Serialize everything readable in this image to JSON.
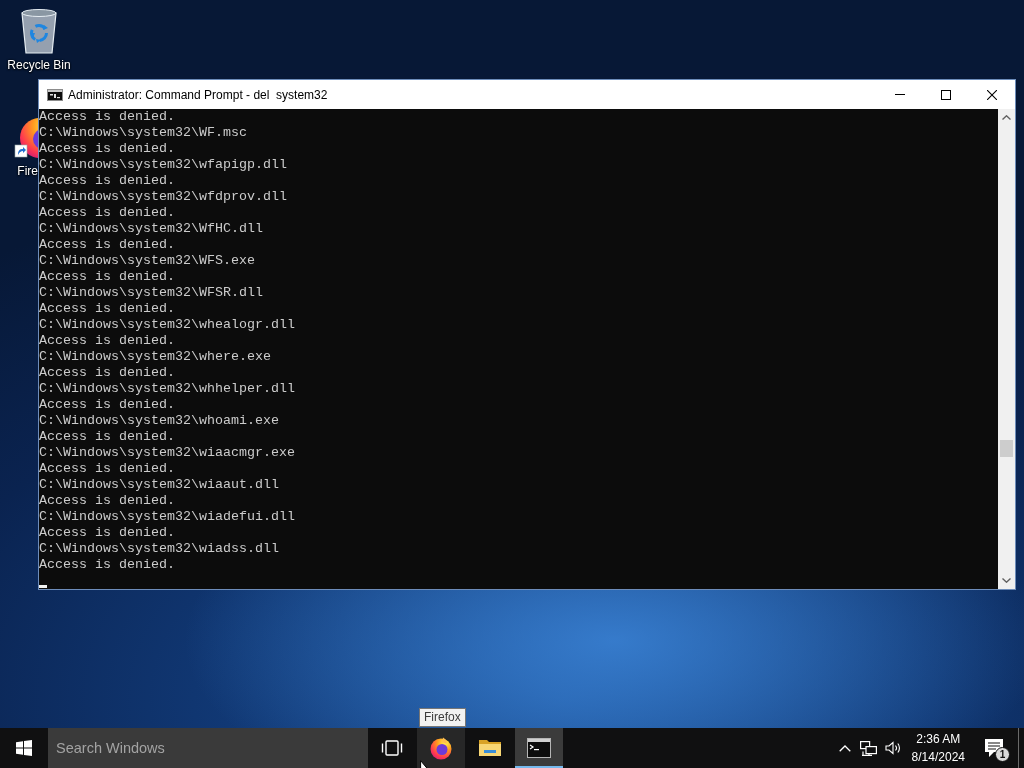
{
  "desktop": {
    "icons": [
      {
        "kind": "recycle-bin",
        "label": "Recycle Bin",
        "covered": false
      },
      {
        "kind": "firefox",
        "label": "Fire",
        "covered": true
      }
    ]
  },
  "window": {
    "title": "Administrator: Command Prompt - del  system32",
    "console_lines": [
      "Access is denied.",
      "C:\\Windows\\system32\\WF.msc",
      "Access is denied.",
      "C:\\Windows\\system32\\wfapigp.dll",
      "Access is denied.",
      "C:\\Windows\\system32\\wfdprov.dll",
      "Access is denied.",
      "C:\\Windows\\system32\\WfHC.dll",
      "Access is denied.",
      "C:\\Windows\\system32\\WFS.exe",
      "Access is denied.",
      "C:\\Windows\\system32\\WFSR.dll",
      "Access is denied.",
      "C:\\Windows\\system32\\whealogr.dll",
      "Access is denied.",
      "C:\\Windows\\system32\\where.exe",
      "Access is denied.",
      "C:\\Windows\\system32\\whhelper.dll",
      "Access is denied.",
      "C:\\Windows\\system32\\whoami.exe",
      "Access is denied.",
      "C:\\Windows\\system32\\wiaacmgr.exe",
      "Access is denied.",
      "C:\\Windows\\system32\\wiaaut.dll",
      "Access is denied.",
      "C:\\Windows\\system32\\wiadefui.dll",
      "Access is denied.",
      "C:\\Windows\\system32\\wiadss.dll",
      "Access is denied."
    ],
    "text_cursor": true
  },
  "taskbar": {
    "search": {
      "placeholder": "Search Windows"
    },
    "apps": [
      {
        "kind": "firefox",
        "hovered": true,
        "selected": false,
        "tooltip": "Firefox"
      },
      {
        "kind": "file-explorer",
        "hovered": false,
        "selected": false
      },
      {
        "kind": "command-prompt",
        "hovered": false,
        "selected": true
      }
    ],
    "clock": {
      "time": "2:36 AM",
      "date": "8/14/2024"
    },
    "notifications": {
      "count": "1"
    }
  }
}
